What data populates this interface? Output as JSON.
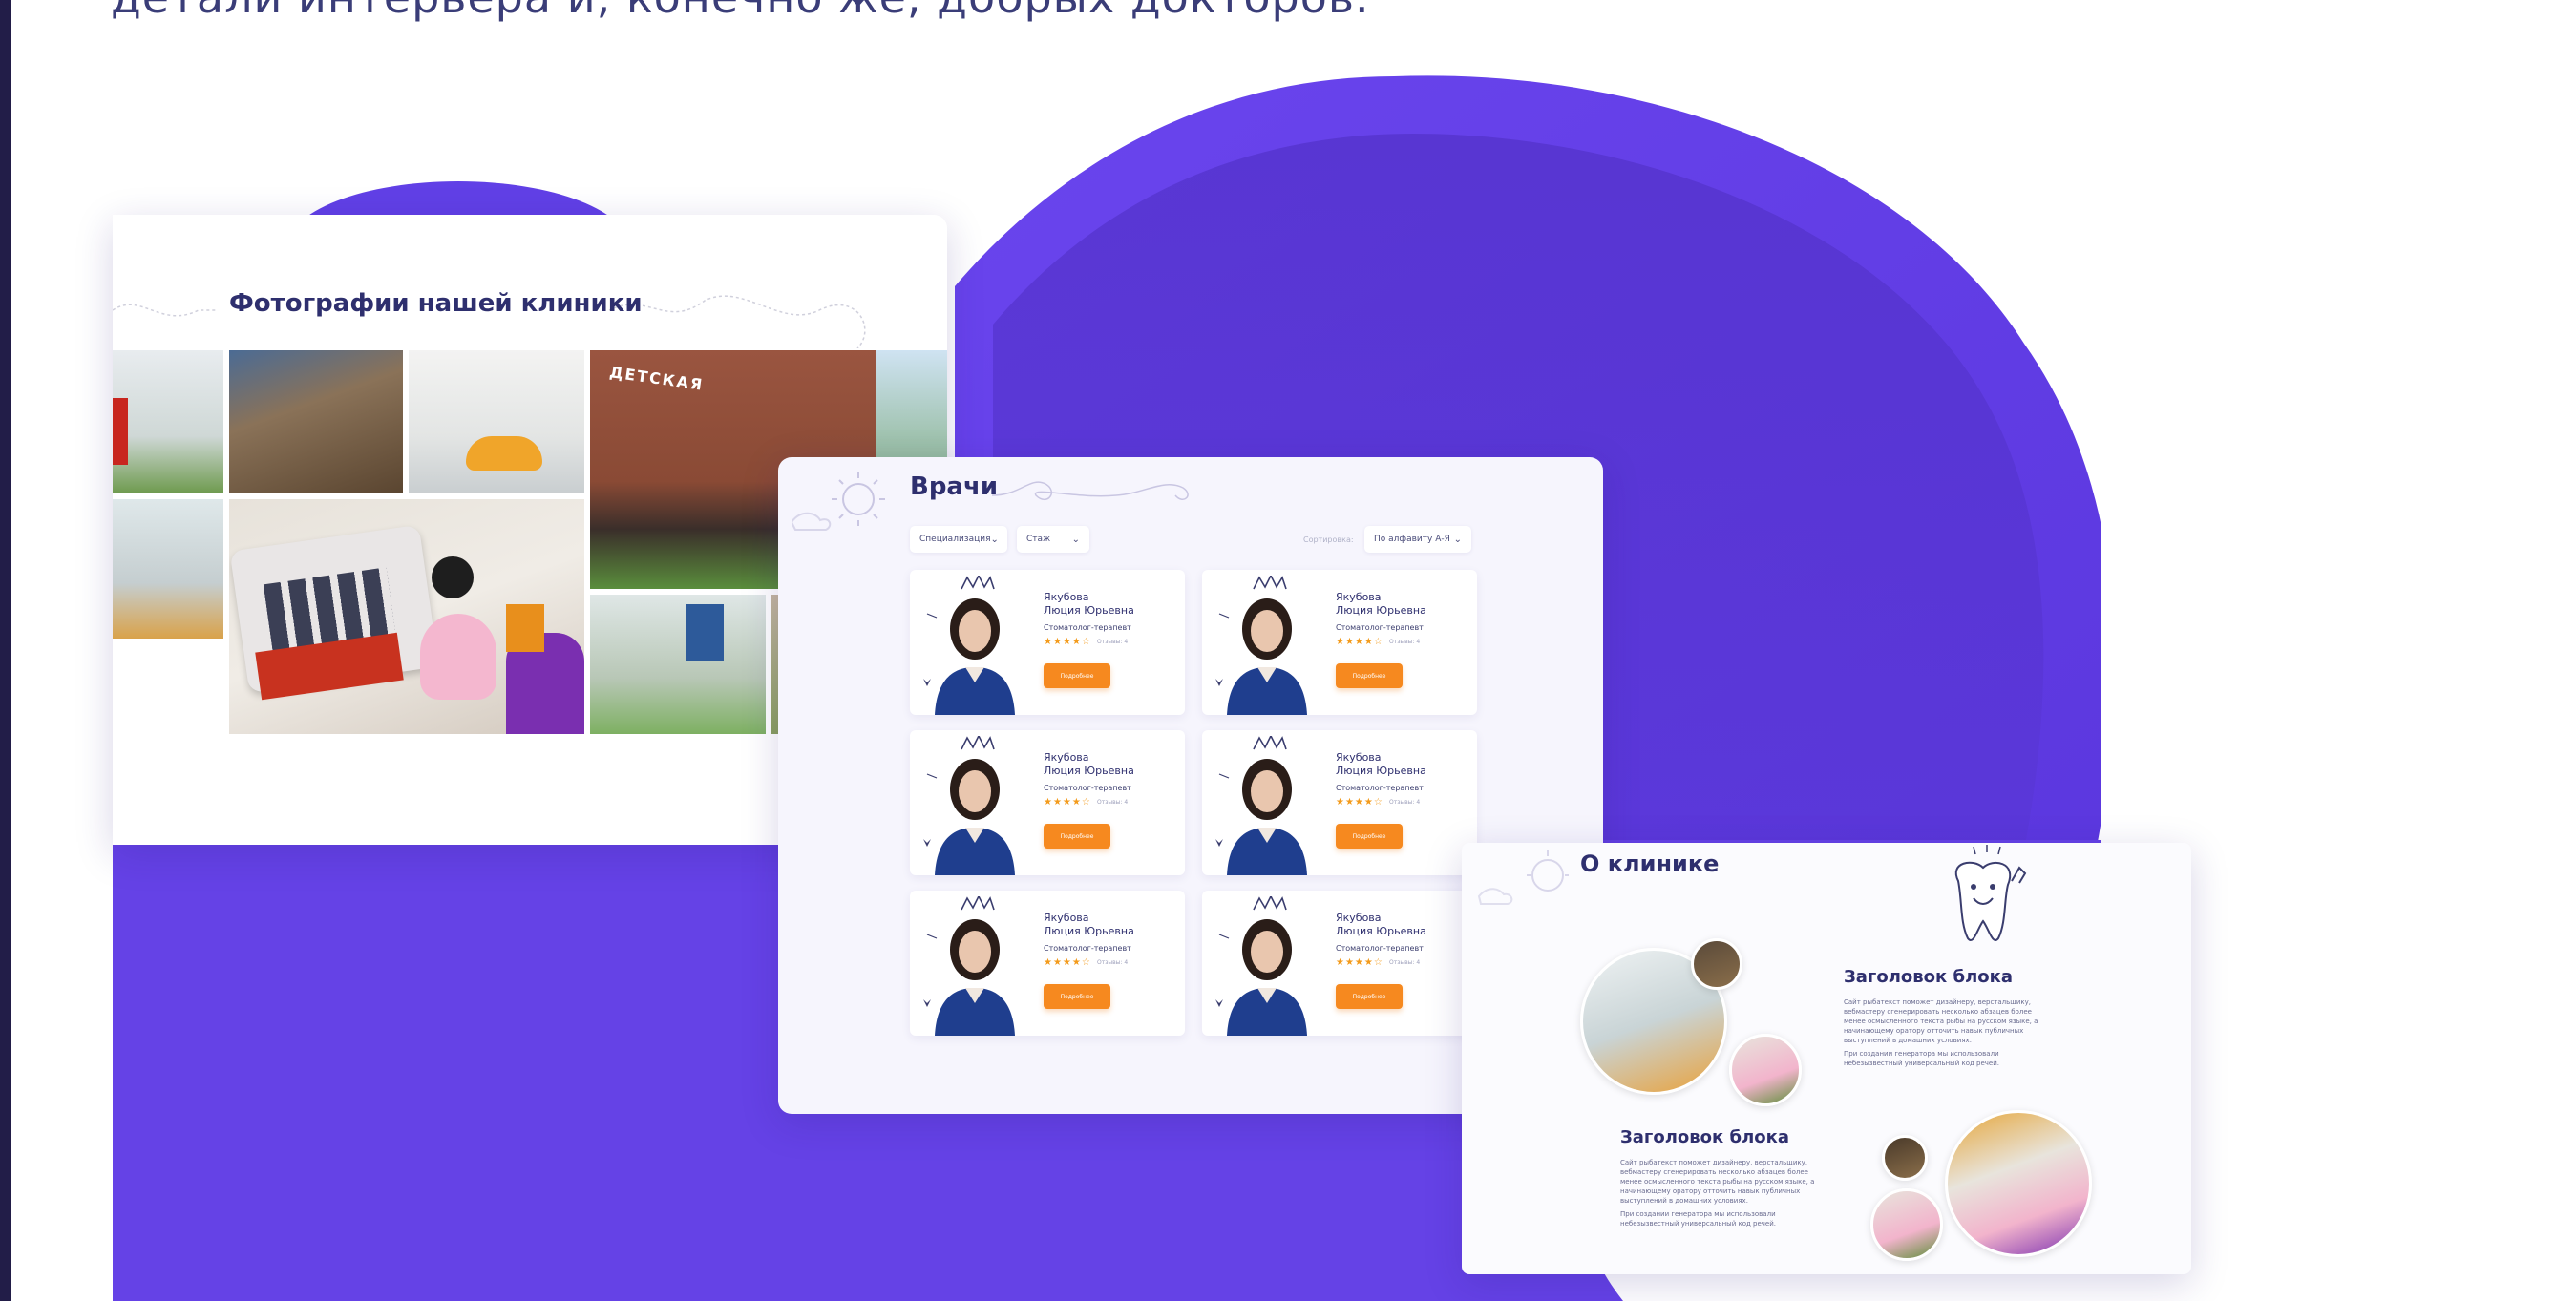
{
  "heading_fragment": "детали интерьера и, конечно же, добрых докторов.",
  "colors": {
    "brand_purple": "#6140e6",
    "deep_purple": "#4f2fc9",
    "accent_orange": "#f6891f",
    "star": "#f39b1c",
    "title_text": "#2e2f6e"
  },
  "photos_panel": {
    "title": "Фотографии нашей клиники",
    "photos": [
      "clinic-interior",
      "building-exterior",
      "dental-chair",
      "storefront",
      "toy-cash-register",
      "corridor",
      "waiting-area",
      "lounge"
    ]
  },
  "doctors_panel": {
    "title": "Врачи",
    "filters": {
      "specialization": "Специализация",
      "experience": "Стаж",
      "sort_label": "Сортировка:",
      "sort": "По алфавиту А-Я"
    },
    "cards": [
      {
        "name_line1": "Якубова",
        "name_line2": "Люция Юрьевна",
        "specialty": "Стоматолог-терапевт",
        "stars": "★★★★☆",
        "reviews": "Отзывы: 4",
        "button": "Подробнее"
      },
      {
        "name_line1": "Якубова",
        "name_line2": "Люция Юрьевна",
        "specialty": "Стоматолог-терапевт",
        "stars": "★★★★☆",
        "reviews": "Отзывы: 4",
        "button": "Подробнее"
      },
      {
        "name_line1": "Якубова",
        "name_line2": "Люция Юрьевна",
        "specialty": "Стоматолог-терапевт",
        "stars": "★★★★☆",
        "reviews": "Отзывы: 4",
        "button": "Подробнее"
      },
      {
        "name_line1": "Якубова",
        "name_line2": "Люция Юрьевна",
        "specialty": "Стоматолог-терапевт",
        "stars": "★★★★☆",
        "reviews": "Отзывы: 4",
        "button": "Подробнее"
      },
      {
        "name_line1": "Якубова",
        "name_line2": "Люция Юрьевна",
        "specialty": "Стоматолог-терапевт",
        "stars": "★★★★☆",
        "reviews": "Отзывы: 4",
        "button": "Подробнее"
      },
      {
        "name_line1": "Якубова",
        "name_line2": "Люция Юрьевна",
        "specialty": "Стоматолог-терапевт",
        "stars": "★★★★☆",
        "reviews": "Отзывы: 4",
        "button": "Подробнее"
      }
    ]
  },
  "about_panel": {
    "title": "О клинике",
    "blocks": [
      {
        "title": "Заголовок блока",
        "paragraph1": "Сайт рыбатекст поможет дизайнеру, верстальщику, вебмастеру сгенерировать несколько абзацев более менее осмысленного текста рыбы на русском языке, а начинающему оратору отточить навык публичных выступлений в домашних условиях.",
        "paragraph2": "При создании генератора мы использовали небезызвестный универсальный код речей."
      },
      {
        "title": "Заголовок блока",
        "paragraph1": "Сайт рыбатекст поможет дизайнеру, верстальщику, вебмастеру сгенерировать несколько абзацев более менее осмысленного текста рыбы на русском языке, а начинающему оратору отточить навык публичных выступлений в домашних условиях.",
        "paragraph2": "При создании генератора мы использовали небезызвестный универсальный код речей."
      }
    ]
  }
}
